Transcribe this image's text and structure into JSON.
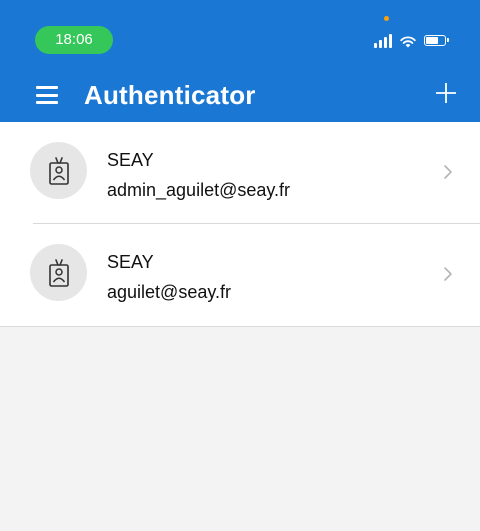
{
  "status_bar": {
    "time": "18:06"
  },
  "header": {
    "title": "Authenticator",
    "menu_icon": "hamburger-menu-icon",
    "add_icon": "plus-icon"
  },
  "accounts": [
    {
      "issuer": "SEAY",
      "email": "admin_aguilet@seay.fr",
      "icon": "badge-id-icon"
    },
    {
      "issuer": "SEAY",
      "email": "aguilet@seay.fr",
      "icon": "badge-id-icon"
    }
  ],
  "colors": {
    "header_bg": "#1a78d4",
    "time_pill": "#35c759",
    "page_bg": "#f3f3f3"
  }
}
